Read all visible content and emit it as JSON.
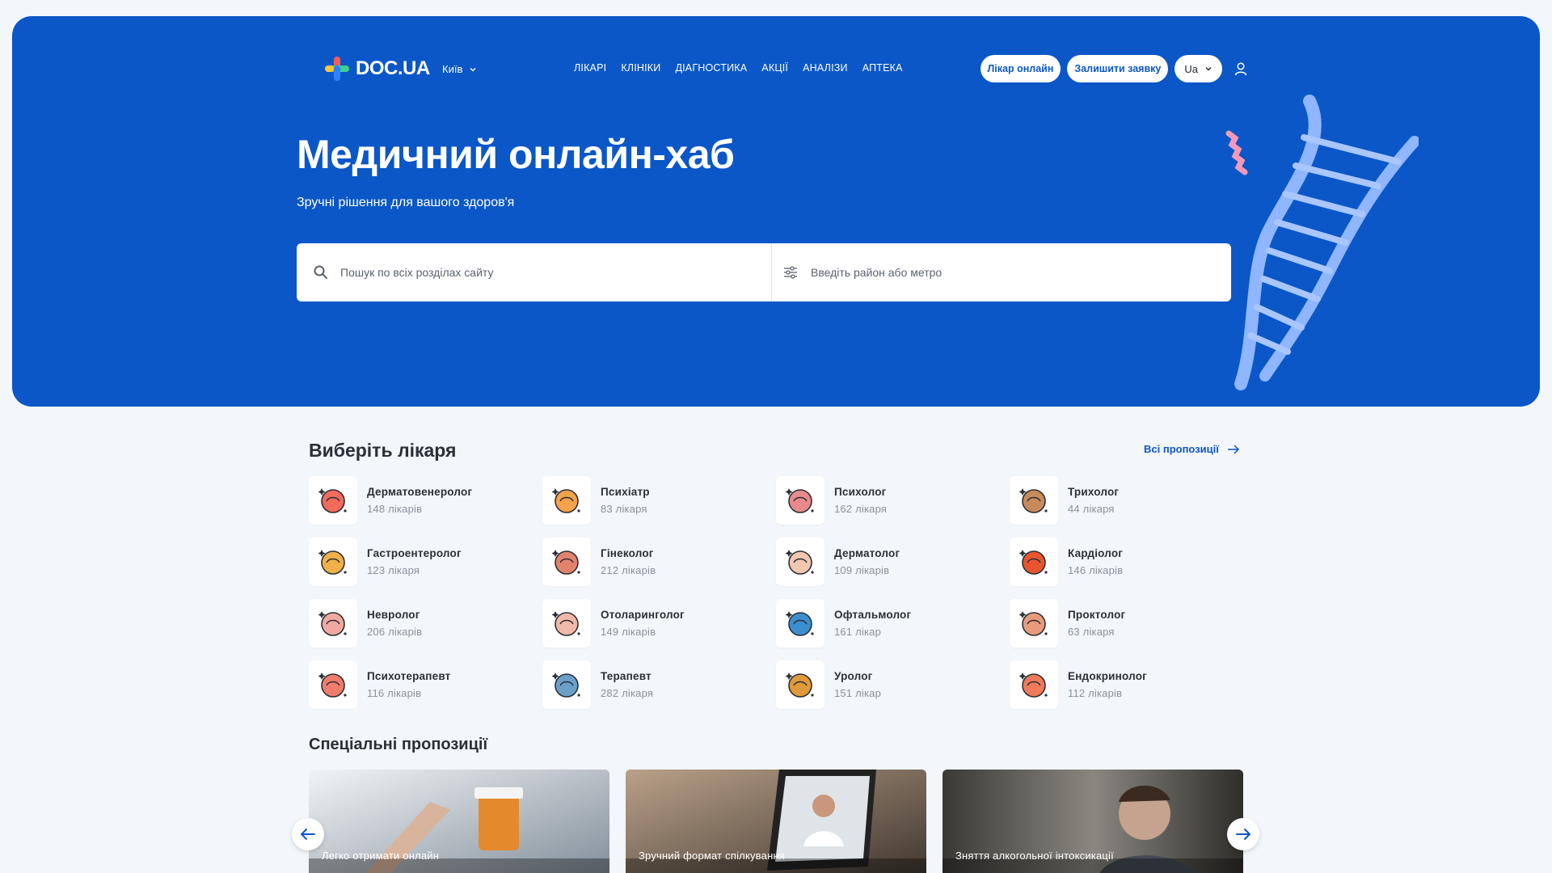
{
  "brand": {
    "name": "DOC.UA",
    "accent": "#0b57c8"
  },
  "nav": {
    "city": "Київ",
    "menu": [
      "ЛІКАРІ",
      "КЛІНІКИ",
      "ДІАГНОСТИКА",
      "АКЦІЇ",
      "АНАЛІЗИ",
      "АПТЕКА"
    ],
    "online_doctor": "Лікар онлайн",
    "leave_request": "Залишити заявку",
    "language": "Ua"
  },
  "hero": {
    "title": "Медичний онлайн-хаб",
    "subtitle": "Зручні рішення для вашого здоров'я",
    "search_placeholder": "Пошук по всіх розділах сайту",
    "location_placeholder": "Введіть район або метро"
  },
  "doctors": {
    "title": "Виберіть лікаря",
    "all_link": "Всі пропозиції",
    "items": [
      {
        "name": "Дерматовенеролог",
        "count": "148 лікарів",
        "icon": "ribbon-icon"
      },
      {
        "name": "Психіатр",
        "count": "83 лікаря",
        "icon": "prescription-icon"
      },
      {
        "name": "Психолог",
        "count": "162 лікаря",
        "icon": "brain-heart-icon"
      },
      {
        "name": "Трихолог",
        "count": "44 лікаря",
        "icon": "hair-icon"
      },
      {
        "name": "Гастроентеролог",
        "count": "123 лікаря",
        "icon": "stomach-icon"
      },
      {
        "name": "Гінеколог",
        "count": "212 лікарів",
        "icon": "uterus-icon"
      },
      {
        "name": "Дерматолог",
        "count": "109 лікарів",
        "icon": "face-icon"
      },
      {
        "name": "Кардіолог",
        "count": "146 лікарів",
        "icon": "heart-icon"
      },
      {
        "name": "Невролог",
        "count": "206 лікарів",
        "icon": "brain-icon"
      },
      {
        "name": "Отоларинголог",
        "count": "149 лікарів",
        "icon": "nose-icon"
      },
      {
        "name": "Офтальмолог",
        "count": "161 лікар",
        "icon": "eye-icon"
      },
      {
        "name": "Проктолог",
        "count": "63 лікаря",
        "icon": "intestine-icon"
      },
      {
        "name": "Психотерапевт",
        "count": "116 лікарів",
        "icon": "head-heart-icon"
      },
      {
        "name": "Терапевт",
        "count": "282 лікаря",
        "icon": "stethoscope-icon"
      },
      {
        "name": "Уролог",
        "count": "151 лікар",
        "icon": "kidney-icon"
      },
      {
        "name": "Ендокринолог",
        "count": "112 лікарів",
        "icon": "thyroid-icon"
      }
    ]
  },
  "offers": {
    "title": "Спеціальні пропозиції",
    "items": [
      {
        "caption": "Легко отримати онлайн",
        "color": "#c9d3dc"
      },
      {
        "caption": "Зручний формат спілкування",
        "color": "#7a6a5c"
      },
      {
        "caption": "Зняття алкогольної інтоксикації",
        "color": "#6f6d68"
      }
    ]
  }
}
